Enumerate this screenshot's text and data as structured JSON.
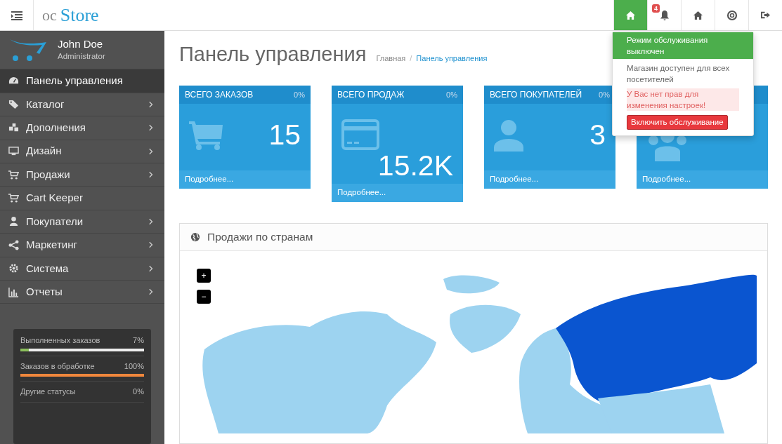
{
  "header": {
    "logo_prefix": "oc",
    "logo_main": "Store",
    "notifications_badge": "4"
  },
  "user": {
    "name": "John Doe",
    "role": "Administrator"
  },
  "sidebar": {
    "items": [
      {
        "label": "Панель управления",
        "selected": true,
        "expandable": false
      },
      {
        "label": "Каталог",
        "selected": false,
        "expandable": true
      },
      {
        "label": "Дополнения",
        "selected": false,
        "expandable": true
      },
      {
        "label": "Дизайн",
        "selected": false,
        "expandable": true
      },
      {
        "label": "Продажи",
        "selected": false,
        "expandable": true
      },
      {
        "label": "Cart Keeper",
        "selected": false,
        "expandable": false
      },
      {
        "label": "Покупатели",
        "selected": false,
        "expandable": true
      },
      {
        "label": "Маркетинг",
        "selected": false,
        "expandable": true
      },
      {
        "label": "Система",
        "selected": false,
        "expandable": true
      },
      {
        "label": "Отчеты",
        "selected": false,
        "expandable": true
      }
    ],
    "stats": [
      {
        "label": "Выполненных заказов",
        "reading": "7%",
        "level": 0.07,
        "color": "#8cbf5c"
      },
      {
        "label": "Заказов в обработке",
        "reading": "100%",
        "level": 1,
        "color": "#f0873c"
      },
      {
        "label": "Другие статусы",
        "reading": "0%"
      }
    ]
  },
  "page": {
    "title": "Панель управления",
    "breadcrumb_separator": "/",
    "breadcrumb": [
      {
        "label": "Главная",
        "current": false
      },
      {
        "label": "Панель управления",
        "current": true
      }
    ]
  },
  "tiles": [
    {
      "title": "ВСЕГО ЗАКАЗОВ",
      "change": "0%",
      "value": "15",
      "link": "Подробнее..."
    },
    {
      "title": "ВСЕГО ПРОДАЖ",
      "change": "0%",
      "value": "15.2K",
      "link": "Подробнее..."
    },
    {
      "title": "ВСЕГО ПОКУПАТЕЛЕЙ",
      "change": "0%",
      "value": "3",
      "link": "Подробнее..."
    },
    {
      "link": "Подробнее..."
    }
  ],
  "map_panel": {
    "title": "Продажи по странам",
    "zoom_in": "+",
    "zoom_out": "−"
  },
  "maintenance_menu": {
    "status": "Режим обслуживания выключен",
    "info": "Магазин доступен для всех посетителей",
    "warning": "У Вас нет прав для изменения настроек!",
    "button": "Включить обслуживание"
  }
}
